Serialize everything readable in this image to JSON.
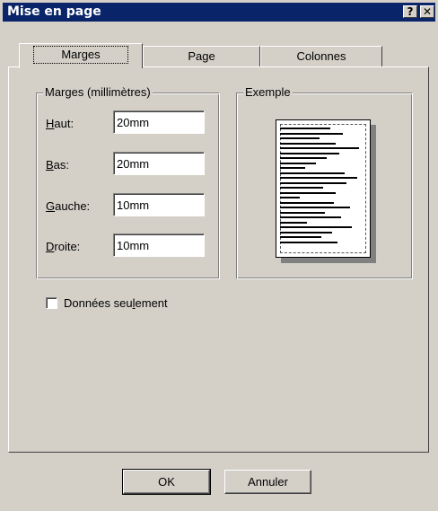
{
  "window": {
    "title": "Mise en page",
    "help_glyph": "?",
    "close_glyph": "✕"
  },
  "tabs": [
    {
      "label": "Marges",
      "active": true
    },
    {
      "label": "Page",
      "active": false
    },
    {
      "label": "Colonnes",
      "active": false
    }
  ],
  "margins": {
    "group_label": "Marges (millimètres)",
    "fields": [
      {
        "label": "Haut:",
        "hotkey": "H",
        "rest": "aut:",
        "value": "20mm"
      },
      {
        "label": "Bas:",
        "hotkey": "B",
        "rest": "as:",
        "value": "20mm"
      },
      {
        "label": "Gauche:",
        "hotkey": "G",
        "rest": "auche:",
        "value": "10mm"
      },
      {
        "label": "Droite:",
        "hotkey": "D",
        "rest": "roite:",
        "value": "10mm"
      }
    ]
  },
  "example": {
    "group_label": "Exemple"
  },
  "data_only": {
    "label_pre": "Données seu",
    "label_hotkey": "l",
    "label_post": "ement",
    "checked": false
  },
  "buttons": {
    "ok": "OK",
    "cancel": "Annuler"
  }
}
